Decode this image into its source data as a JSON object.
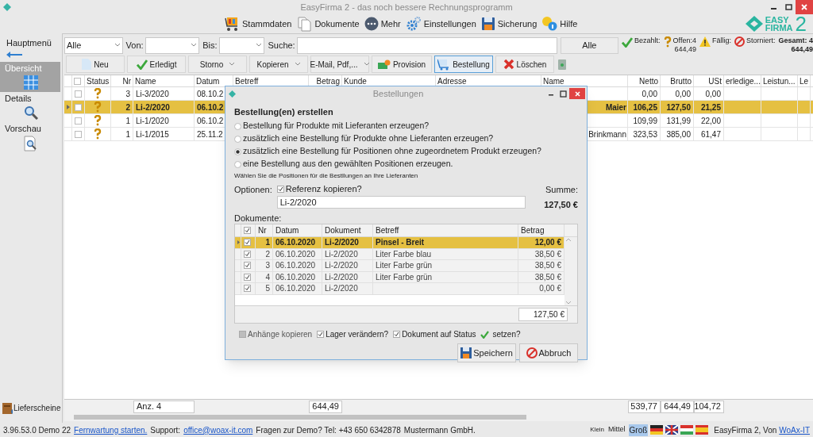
{
  "window": {
    "title": "EasyFirma 2 - das noch bessere Rechnungsprogramm"
  },
  "toolbar": [
    {
      "label": "Stammdaten"
    },
    {
      "label": "Dokumente"
    },
    {
      "label": "Mehr"
    },
    {
      "label": "Einstellungen"
    },
    {
      "label": "Sicherung"
    },
    {
      "label": "Hilfe"
    }
  ],
  "logo": {
    "line_1": "EASY",
    "line_2": "FIRMA",
    "numeral": "2"
  },
  "sidebar": {
    "back_label": "Hauptmenü",
    "items": [
      {
        "label": "Übersicht",
        "selected": true
      },
      {
        "label": "Details",
        "selected": false
      },
      {
        "label": "Vorschau",
        "selected": false
      }
    ],
    "footer_label": "Lieferscheine"
  },
  "filters": {
    "type_select": "Alle",
    "from_label": "Von:",
    "to_label": "Bis:",
    "search_label": "Suche:",
    "reset_button": "Alle"
  },
  "stats": [
    {
      "label": "Bezahlt:",
      "kind": "paid"
    },
    {
      "label": "Offen:4",
      "value": "644,49",
      "kind": "open"
    },
    {
      "label": "Fällig:",
      "kind": "due"
    },
    {
      "label": "Storniert:",
      "kind": "cancelled"
    },
    {
      "label": "Gesamt: 4",
      "value": "644,49",
      "kind": "total"
    }
  ],
  "actions": [
    {
      "label": "Neu",
      "kind": "new",
      "dropdown": false,
      "selected": false
    },
    {
      "label": "Erledigt",
      "kind": "done",
      "dropdown": false,
      "selected": false
    },
    {
      "label": "Storno",
      "kind": "plain",
      "dropdown": true,
      "selected": false
    },
    {
      "label": "Kopieren",
      "kind": "plain",
      "dropdown": true,
      "selected": false
    },
    {
      "label": "E-Mail, Pdf,...",
      "kind": "plain",
      "dropdown": true,
      "selected": false
    },
    {
      "label": "Provision",
      "kind": "commission",
      "dropdown": false,
      "selected": false
    },
    {
      "label": "Bestellung",
      "kind": "order",
      "dropdown": false,
      "selected": true
    },
    {
      "label": "Löschen",
      "kind": "delete",
      "dropdown": false,
      "selected": false
    }
  ],
  "table": {
    "header_checked": false,
    "columns": [
      "Status",
      "Nr",
      "Name",
      "Datum",
      "Betreff",
      "Betrag",
      "Kunde",
      "Adresse",
      "Name",
      "Netto",
      "Brutto",
      "USt",
      "erledige...",
      "Leistun...",
      "Le"
    ],
    "rows": [
      {
        "kind": "open",
        "nr": "3",
        "name": "Li-3/2020",
        "datum": "08.10.2",
        "name_2": "",
        "netto": "0,00",
        "brutto": "0,00",
        "ust": "0,00",
        "checked": false,
        "selected": false
      },
      {
        "kind": "open",
        "nr": "2",
        "name": "Li-2/2020",
        "datum": "06.10.2",
        "name_2": "Maier",
        "netto": "106,25",
        "brutto": "127,50",
        "ust": "21,25",
        "checked": false,
        "selected": true
      },
      {
        "kind": "open",
        "nr": "1",
        "name": "Li-1/2020",
        "datum": "06.10.2",
        "name_2": "",
        "netto": "109,99",
        "brutto": "131,99",
        "ust": "22,00",
        "checked": false,
        "selected": false
      },
      {
        "kind": "open",
        "nr": "1",
        "name": "Li-1/2015",
        "datum": "25.11.2",
        "name_2": "Brinkmann",
        "netto": "323,53",
        "brutto": "385,00",
        "ust": "61,47",
        "checked": false,
        "selected": false
      }
    ],
    "totals": {
      "count": "Anz. 4",
      "betrag": "644,49",
      "netto": "539,77",
      "brutto": "644,49",
      "ust": "104,72"
    }
  },
  "dialog": {
    "title": "Bestellungen",
    "heading": "Bestellung(en) erstellen",
    "options": [
      {
        "label": "Bestellung für Produkte mit Lieferanten erzeugen?",
        "selected": false
      },
      {
        "label": "zusätzlich eine Bestellung für Produkte ohne Lieferanten erzeugen?",
        "selected": false
      },
      {
        "label": "zusätzlich eine Bestellung für Positionen ohne zugeordnetem Produkt erzeugen?",
        "selected": true
      },
      {
        "label": "eine Bestellung aus den gewählten Positionen erzeugen.",
        "selected": false
      }
    ],
    "hint": "Wählen Sie die Positionen für die Bestllungen an Ihre Lieferanten",
    "options_label": "Optionen:",
    "copy_reference": {
      "label": "Referenz kopieren?",
      "checked": true
    },
    "reference": "Li-2/2020",
    "sum_label": "Summe:",
    "sum": "127,50 €",
    "documents_label": "Dokumente:",
    "grid": {
      "columns": [
        "Nr",
        "Datum",
        "Dokument",
        "Betreff",
        "Betrag"
      ],
      "header_checked": true,
      "rows": [
        {
          "checked": true,
          "nr": "1",
          "datum": "06.10.2020",
          "dokument": "Li-2/2020",
          "betreff": "Pinsel - Breit",
          "betrag": "12,00 €",
          "selected": true
        },
        {
          "checked": true,
          "nr": "2",
          "datum": "06.10.2020",
          "dokument": "Li-2/2020",
          "betreff": "Liter Farbe blau",
          "betrag": "38,50 €",
          "selected": false
        },
        {
          "checked": true,
          "nr": "3",
          "datum": "06.10.2020",
          "dokument": "Li-2/2020",
          "betreff": "Liter Farbe grün",
          "betrag": "38,50 €",
          "selected": false
        },
        {
          "checked": true,
          "nr": "4",
          "datum": "06.10.2020",
          "dokument": "Li-2/2020",
          "betreff": "Liter Farbe grün",
          "betrag": "38,50 €",
          "selected": false
        },
        {
          "checked": true,
          "nr": "5",
          "datum": "06.10.2020",
          "dokument": "Li-2/2020",
          "betreff": "",
          "betrag": "0,00 €",
          "selected": false
        }
      ],
      "total": "127,50 €"
    },
    "attachments": {
      "label": "Anhänge kopieren",
      "checked": false,
      "disabled": true
    },
    "stock": {
      "label": "Lager verändern?",
      "checked": true
    },
    "status": {
      "label": "Dokument auf Status",
      "suffix": "setzen?",
      "checked": true
    },
    "save_button": "Speichern",
    "cancel_button": "Abbruch"
  },
  "status_bar": {
    "version": "3.96.53.0 Demo 22",
    "remote_link": "Fernwartung starten.",
    "support_label": "Support:",
    "email_link": "office@woax-it.com",
    "demo_text": "Fragen zur Demo? Tel: +43 650 6342878",
    "company": "Mustermann GmbH.",
    "sizes": [
      {
        "label": "Klein",
        "selected": false
      },
      {
        "label": "Mittel",
        "selected": false
      },
      {
        "label": "Groß",
        "selected": true
      }
    ],
    "credit": "EasyFirma 2, Von",
    "credit_link": "WoAx-IT"
  }
}
